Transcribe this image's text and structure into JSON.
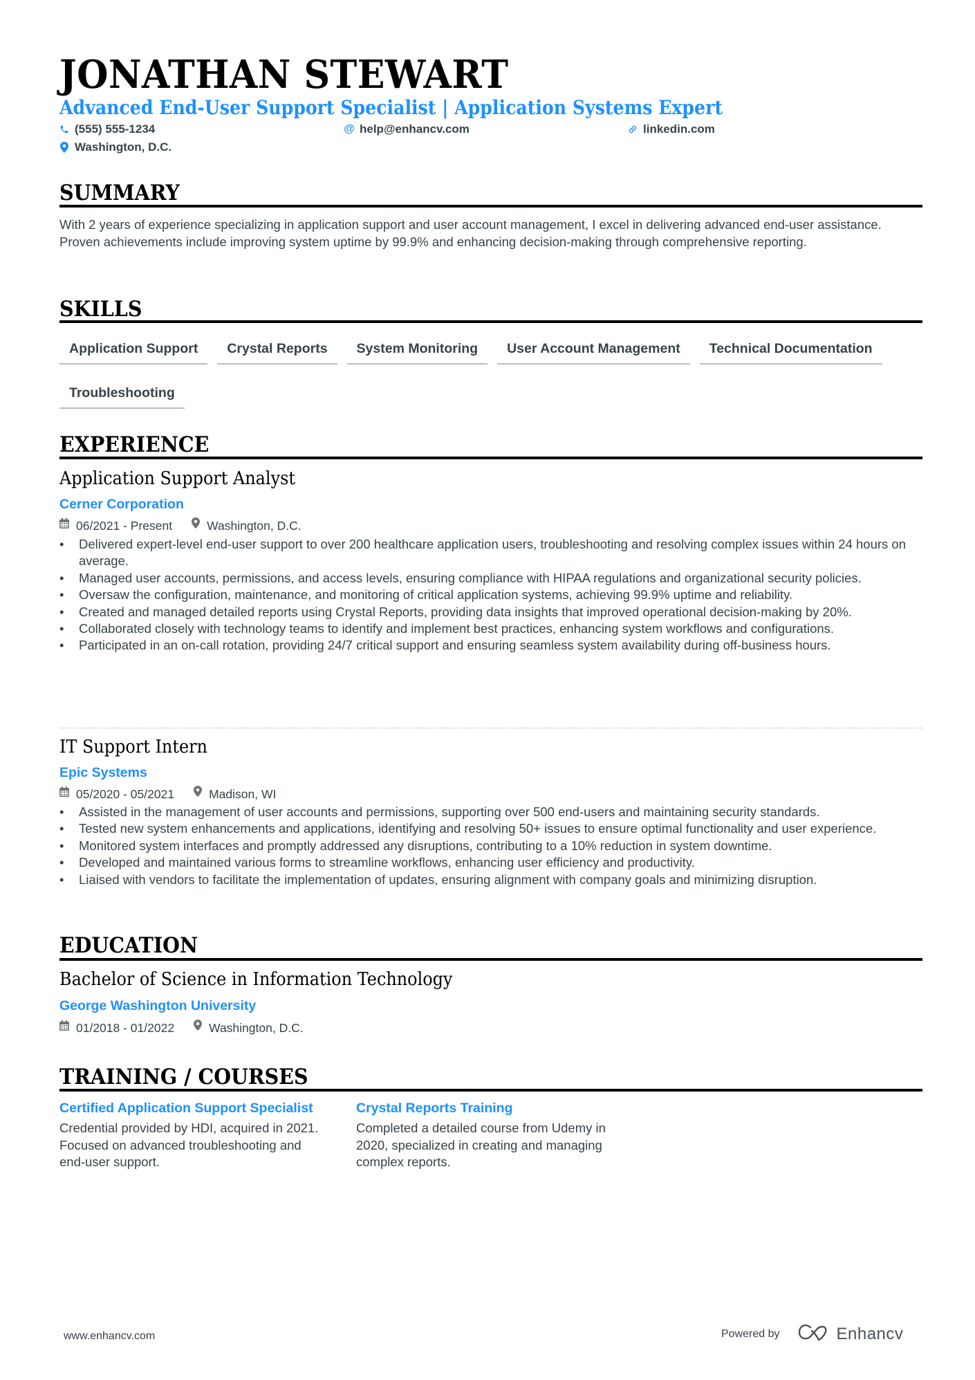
{
  "header": {
    "name": "JONATHAN STEWART",
    "headline": "Advanced End-User Support Specialist | Application Systems Expert",
    "contacts": {
      "phone": {
        "icon": "phone-icon",
        "value": "(555) 555-1234"
      },
      "email": {
        "icon": "at-icon",
        "value": "help@enhancv.com"
      },
      "linkedin": {
        "icon": "link-icon",
        "value": "linkedin.com"
      },
      "location": {
        "icon": "location-pin-icon",
        "value": "Washington, D.C."
      }
    }
  },
  "sections": {
    "summary": {
      "title": "SUMMARY",
      "text": "With 2 years of experience specializing in application support and user account management, I excel in delivering advanced end-user assistance. Proven achievements include improving system uptime by 99.9% and enhancing decision-making through comprehensive reporting."
    },
    "skills": {
      "title": "SKILLS",
      "items": [
        "Application Support",
        "Crystal Reports",
        "System Monitoring",
        "User Account Management",
        "Technical Documentation",
        "Troubleshooting"
      ]
    },
    "experience": {
      "title": "EXPERIENCE",
      "jobs": [
        {
          "title": "Application Support Analyst",
          "company": "Cerner Corporation",
          "dates": "06/2021 - Present",
          "location": "Washington, D.C.",
          "bullets": [
            "Delivered expert-level end-user support to over 200 healthcare application users, troubleshooting and resolving complex issues within 24 hours on average.",
            "Managed user accounts, permissions, and access levels, ensuring compliance with HIPAA regulations and organizational security policies.",
            "Oversaw the configuration, maintenance, and monitoring of critical application systems, achieving 99.9% uptime and reliability.",
            "Created and managed detailed reports using Crystal Reports, providing data insights that improved operational decision-making by 20%.",
            "Collaborated closely with technology teams to identify and implement best practices, enhancing system workflows and configurations.",
            "Participated in an on-call rotation, providing 24/7 critical support and ensuring seamless system availability during off-business hours."
          ]
        },
        {
          "title": "IT Support Intern",
          "company": "Epic Systems",
          "dates": "05/2020 - 05/2021",
          "location": "Madison, WI",
          "bullets": [
            "Assisted in the management of user accounts and permissions, supporting over 500 end-users and maintaining security standards.",
            "Tested new system enhancements and applications, identifying and resolving 50+ issues to ensure optimal functionality and user experience.",
            "Monitored system interfaces and promptly addressed any disruptions, contributing to a 10% reduction in system downtime.",
            "Developed and maintained various forms to streamline workflows, enhancing user efficiency and productivity.",
            "Liaised with vendors to facilitate the implementation of updates, ensuring alignment with company goals and minimizing disruption."
          ]
        }
      ]
    },
    "education": {
      "title": "EDUCATION",
      "degree": "Bachelor of Science in Information Technology",
      "school": "George Washington University",
      "dates": "01/2018 - 01/2022",
      "location": "Washington, D.C."
    },
    "training": {
      "title": "TRAINING / COURSES",
      "items": [
        {
          "title": "Certified Application Support Specialist",
          "description": "Credential provided by HDI, acquired in 2021. Focused on advanced troubleshooting and end-user support."
        },
        {
          "title": "Crystal Reports Training",
          "description": "Completed a detailed course from Udemy in 2020, specialized in creating and managing complex reports."
        }
      ]
    }
  },
  "footer": {
    "website": "www.enhancv.com",
    "powered_by": "Powered by",
    "brand": "Enhancv"
  },
  "icons": {
    "calendar": "calendar-icon",
    "location": "location-pin-icon"
  },
  "colors": {
    "accent": "#1e90ff",
    "text": "#384347",
    "heading": "#000000"
  }
}
